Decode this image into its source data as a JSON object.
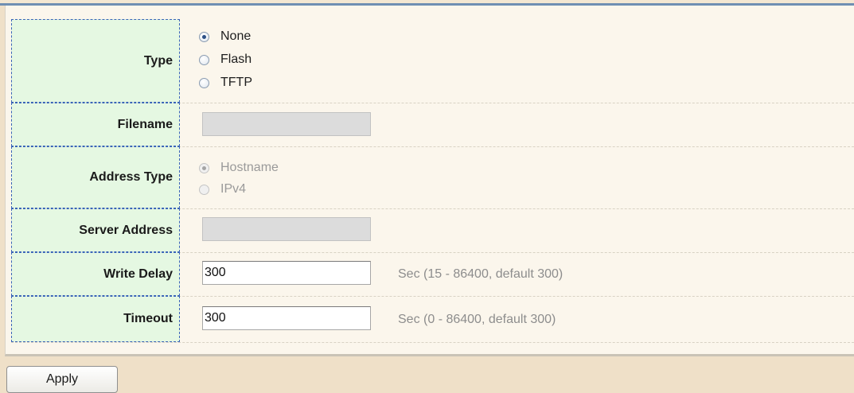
{
  "form": {
    "type": {
      "label": "Type",
      "options": [
        {
          "label": "None",
          "checked": true
        },
        {
          "label": "Flash",
          "checked": false
        },
        {
          "label": "TFTP",
          "checked": false
        }
      ]
    },
    "filename": {
      "label": "Filename",
      "value": ""
    },
    "address_type": {
      "label": "Address Type",
      "options": [
        {
          "label": "Hostname",
          "checked": true,
          "disabled": true
        },
        {
          "label": "IPv4",
          "checked": false,
          "disabled": true
        }
      ]
    },
    "server_address": {
      "label": "Server Address",
      "value": ""
    },
    "write_delay": {
      "label": "Write Delay",
      "value": "300",
      "hint": "Sec (15 - 86400, default 300)"
    },
    "timeout": {
      "label": "Timeout",
      "value": "300",
      "hint": "Sec (0 - 86400, default 300)"
    }
  },
  "actions": {
    "apply_label": "Apply"
  }
}
